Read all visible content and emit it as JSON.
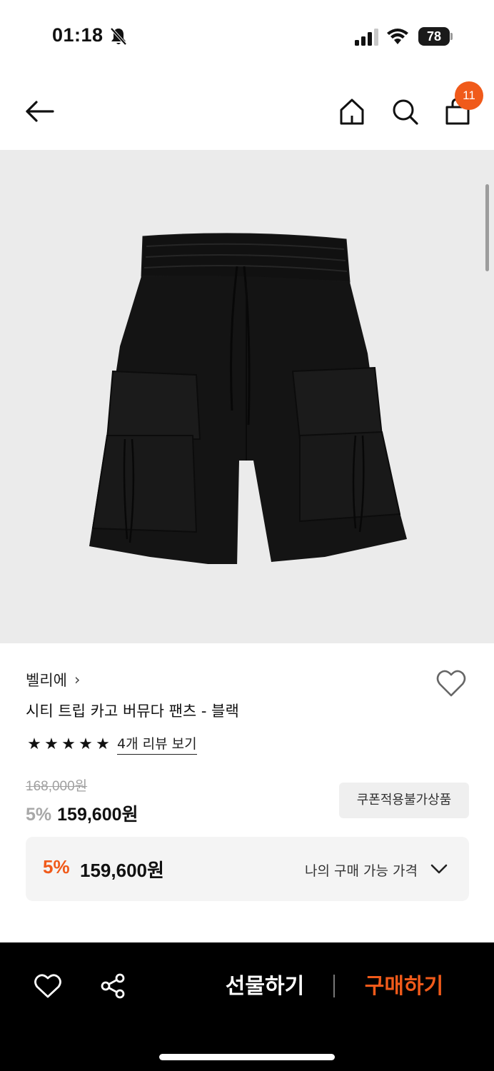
{
  "status_bar": {
    "time": "01:18",
    "battery": "78",
    "icons": [
      "bell-off-icon",
      "signal-icon",
      "wifi-icon",
      "battery-icon"
    ]
  },
  "nav": {
    "cart_count": "11",
    "icons": [
      "arrow-left-icon",
      "home-icon",
      "search-icon",
      "shopping-bag-icon"
    ]
  },
  "product": {
    "brand": "벨리에",
    "brand_chevron": "›",
    "title": "시티 트립 카고 버뮤다 팬츠 - 블랙",
    "rating_stars": 5,
    "review_link": "4개 리뷰 보기",
    "original_price": "168,000원",
    "discount_pct": "5%",
    "sale_price": "159,600원",
    "coupon_note": "쿠폰적용불가상품"
  },
  "my_price": {
    "discount_pct": "5%",
    "price": "159,600원",
    "label": "나의 구매 가능 가격"
  },
  "bottom_bar": {
    "gift_label": "선물하기",
    "buy_label": "구매하기"
  },
  "colors": {
    "accent": "#f05a1a",
    "image_bg": "#ebebeb",
    "bottom_bar_bg": "#000000"
  }
}
